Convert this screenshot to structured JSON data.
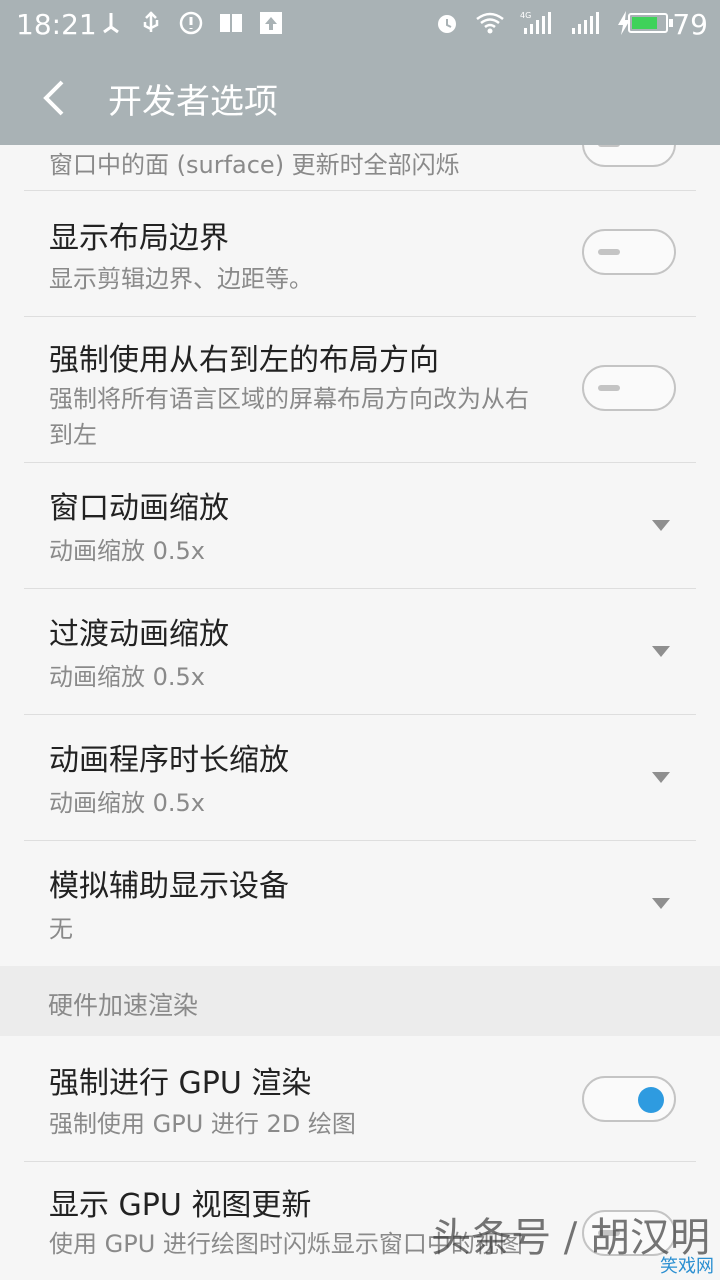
{
  "status_bar": {
    "time": "18:21",
    "battery_percent": "79",
    "battery_level": 0.79,
    "network": "4G"
  },
  "header": {
    "title": "开发者选项"
  },
  "partial_row": {
    "subtitle": "窗口中的面 (surface) 更新时全部闪烁"
  },
  "rows": [
    {
      "title": "显示布局边界",
      "subtitle": "显示剪辑边界、边距等。",
      "control": "toggle",
      "on": false
    },
    {
      "title": "强制使用从右到左的布局方向",
      "subtitle": "强制将所有语言区域的屏幕布局方向改为从右到左",
      "control": "toggle",
      "on": false
    },
    {
      "title": "窗口动画缩放",
      "subtitle": "动画缩放 0.5x",
      "control": "dropdown"
    },
    {
      "title": "过渡动画缩放",
      "subtitle": "动画缩放 0.5x",
      "control": "dropdown"
    },
    {
      "title": "动画程序时长缩放",
      "subtitle": "动画缩放 0.5x",
      "control": "dropdown"
    },
    {
      "title": "模拟辅助显示设备",
      "subtitle": "无",
      "control": "dropdown"
    }
  ],
  "section": {
    "label": "硬件加速渲染"
  },
  "hw_rows": [
    {
      "title": "强制进行 GPU 渲染",
      "subtitle": "强制使用 GPU 进行 2D 绘图",
      "control": "toggle",
      "on": true
    },
    {
      "title": "显示 GPU 视图更新",
      "subtitle": "使用 GPU 进行绘图时闪烁显示窗口中的视图",
      "control": "toggle",
      "on": false
    }
  ],
  "watermark": {
    "text": "头条号 / 胡汉明",
    "logo": "笑戏网"
  },
  "colors": {
    "header_bg": "#a9b2b5",
    "toggle_on": "#2e9be0",
    "battery": "#3fd25a"
  }
}
